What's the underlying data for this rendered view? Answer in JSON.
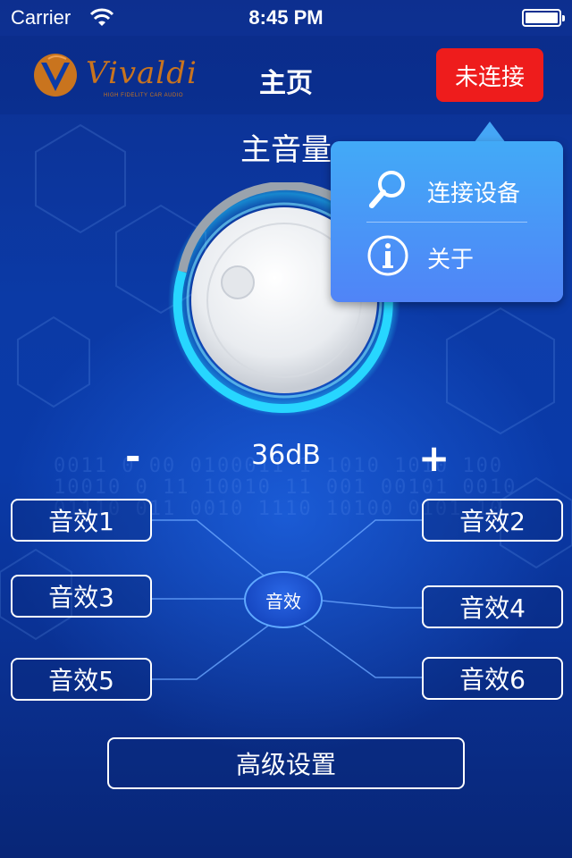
{
  "status_bar": {
    "carrier": "Carrier",
    "time": "8:45 PM",
    "wifi_icon": "wifi-icon",
    "battery_icon": "battery-full-icon"
  },
  "nav": {
    "logo_text": "Vivaldi",
    "logo_tagline": "HIGH FIDELITY CAR AUDIO",
    "logo_icon": "vivaldi-logo",
    "title": "主页",
    "connect_button": "未连接"
  },
  "volume": {
    "title": "主音量",
    "value": "36dB",
    "minus_label": "-",
    "plus_label": "+",
    "knob_icon": "volume-knob-icon"
  },
  "effects": {
    "center_label": "音效",
    "items": [
      {
        "label": "音效1"
      },
      {
        "label": "音效2"
      },
      {
        "label": "音效3"
      },
      {
        "label": "音效4"
      },
      {
        "label": "音效5"
      },
      {
        "label": "音效6"
      }
    ]
  },
  "advanced_button": "高级设置",
  "popover": {
    "items": [
      {
        "label": "连接设备",
        "icon": "search-icon"
      },
      {
        "label": "关于",
        "icon": "info-icon"
      }
    ]
  },
  "colors": {
    "background": "#0b3aa6",
    "connect_red": "#ee1c1c",
    "popover_blue": "#4b8ff8",
    "knob_glow": "#22d8ff",
    "logo_orange": "#c9741e"
  }
}
